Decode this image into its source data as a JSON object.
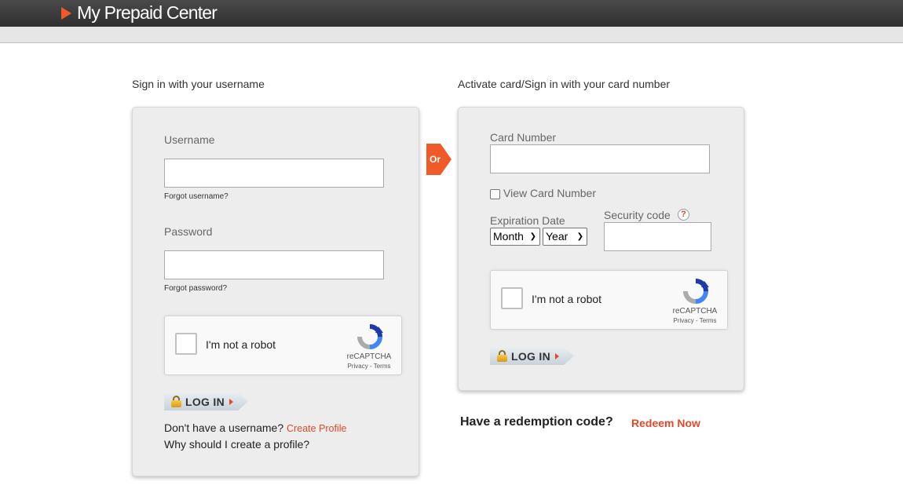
{
  "header": {
    "brand": "My Prepaid Center"
  },
  "username_signin": {
    "title": "Sign in with your username",
    "username_label": "Username",
    "username_value": "",
    "forgot_username": "Forgot username?",
    "password_label": "Password",
    "password_value": "",
    "forgot_password": "Forgot password?",
    "recaptcha": {
      "label": "I'm not a robot",
      "brand": "reCAPTCHA",
      "links": "Privacy - Terms"
    },
    "login_label": "LOG IN",
    "no_username_text": "Don't have a username?",
    "create_profile": "Create Profile",
    "why_profile": "Why should I create a profile?"
  },
  "or_badge": "Or",
  "card_signin": {
    "title": "Activate card/Sign in with your card number",
    "card_number_label": "Card Number",
    "card_number_value": "",
    "view_card_number": "View Card Number",
    "expiration_label": "Expiration Date",
    "month_value": "Month",
    "year_value": "Year",
    "security_label": "Security code",
    "help_icon": "?",
    "security_value": "",
    "recaptcha": {
      "label": "I'm not a robot",
      "brand": "reCAPTCHA",
      "links": "Privacy - Terms"
    },
    "login_label": "LOG IN"
  },
  "redemption": {
    "question": "Have a redemption code?",
    "link": "Redeem Now"
  },
  "colors": {
    "accent": "#f05a28",
    "link": "#e2492b",
    "panel": "#ededed",
    "header": "#3a3a3a"
  }
}
